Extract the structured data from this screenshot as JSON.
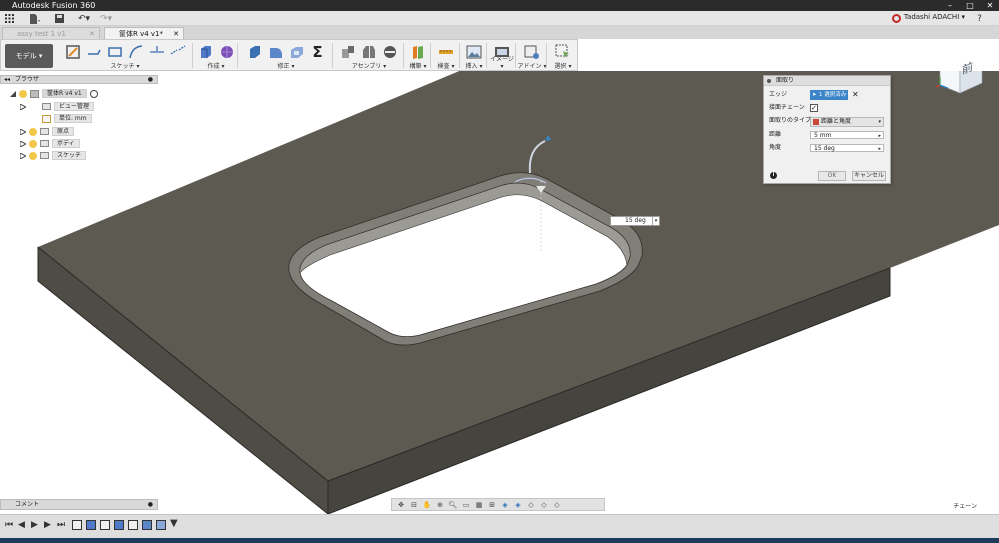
{
  "window": {
    "title": "Autodesk Fusion 360"
  },
  "appbar": {
    "user_name": "Tadashi ADACHI ▾"
  },
  "tabs": [
    {
      "label": "assy test 1 v1",
      "active": false
    },
    {
      "label": "筐体R v4 v1*",
      "active": true
    }
  ],
  "toolbar": {
    "model_label": "モデル ▾",
    "groups": [
      {
        "label": "スケッチ ▾"
      },
      {
        "label": "作成 ▾"
      },
      {
        "label": "修正 ▾"
      },
      {
        "label": "アセンブリ ▾"
      },
      {
        "label": "構築 ▾"
      },
      {
        "label": "検査 ▾"
      },
      {
        "label": "挿入 ▾"
      },
      {
        "label": "イメージ ▾"
      },
      {
        "label": "アドイン ▾"
      },
      {
        "label": "選択 ▾"
      }
    ]
  },
  "browser": {
    "title": "ブラウザ",
    "root": "筐体R v4 v1",
    "items": [
      "ビュー管理",
      "単位: mm",
      "原点",
      "ボディ",
      "スケッチ"
    ]
  },
  "viewcube": {
    "face": "前"
  },
  "chamfer_dialog": {
    "title": "面取り",
    "edge_label": "エッジ",
    "edge_value": "1 選択済み",
    "chain_label": "接面チェーン",
    "chain_checked": true,
    "type_label": "面取りのタイプ",
    "type_value": "距離と角度",
    "distance_label": "距離",
    "distance_value": "5 mm",
    "angle_label": "角度",
    "angle_value": "15 deg",
    "ok_label": "OK",
    "cancel_label": "キャンセル"
  },
  "angle_field": {
    "value": "15 deg"
  },
  "comments": {
    "title": "コメント"
  },
  "chain_text": "チェーン",
  "colors": {
    "titlebar": "#2b2b2b",
    "plate_top": "#5d5a52",
    "plate_side": "#4a4841",
    "selection": "#3a84c7"
  }
}
